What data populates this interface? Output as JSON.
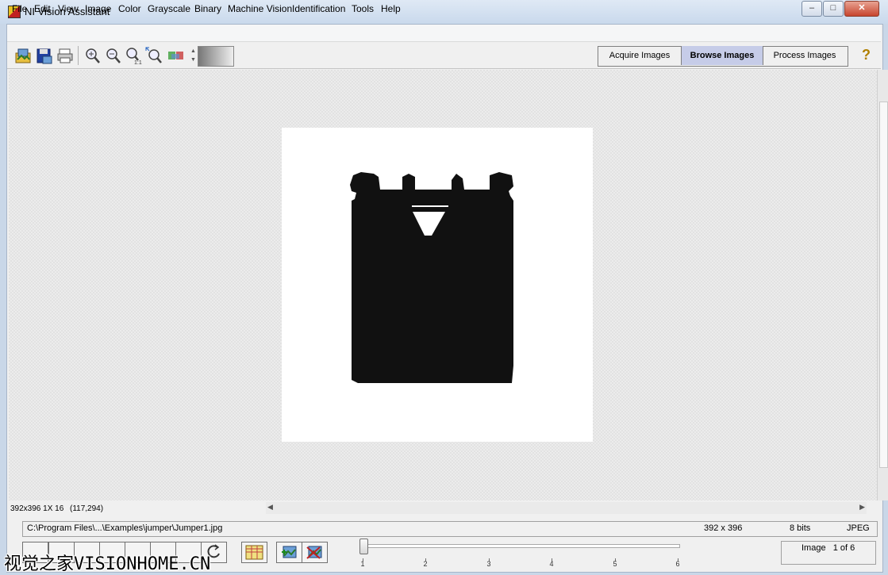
{
  "window": {
    "title": "NI Vision Assistant"
  },
  "menu": [
    "File",
    "Edit",
    "View",
    "Image",
    "Color",
    "Grayscale",
    "Binary",
    "Machine Vision",
    "Identification",
    "Tools",
    "Help"
  ],
  "toolbar": {
    "icons": [
      "open-image-icon",
      "save-image-icon",
      "print-icon",
      "zoom-in-icon",
      "zoom-out-icon",
      "zoom-1to1-icon",
      "zoom-fit-icon",
      "image-palette-icon"
    ]
  },
  "tabs": {
    "acquire": "Acquire Images",
    "browse": "Browse Images",
    "process": "Process Images"
  },
  "help": "?",
  "status": {
    "dims": "392x396 1X 16",
    "coords": "(117,294)"
  },
  "info": {
    "path": "C:\\Program Files\\...\\Examples\\jumper\\Jumper1.jpg",
    "size": "392 x 396",
    "bits": "8 bits",
    "format": "JPEG"
  },
  "slider": {
    "ticks": [
      "1",
      "2",
      "3",
      "4",
      "5",
      "6"
    ],
    "value": 1
  },
  "image_count": "Image   1 of 6",
  "watermark": "视觉之家VISIONHOME.CN",
  "colors": {
    "active_tab": "#c6cce8",
    "accent": "#c02020"
  }
}
